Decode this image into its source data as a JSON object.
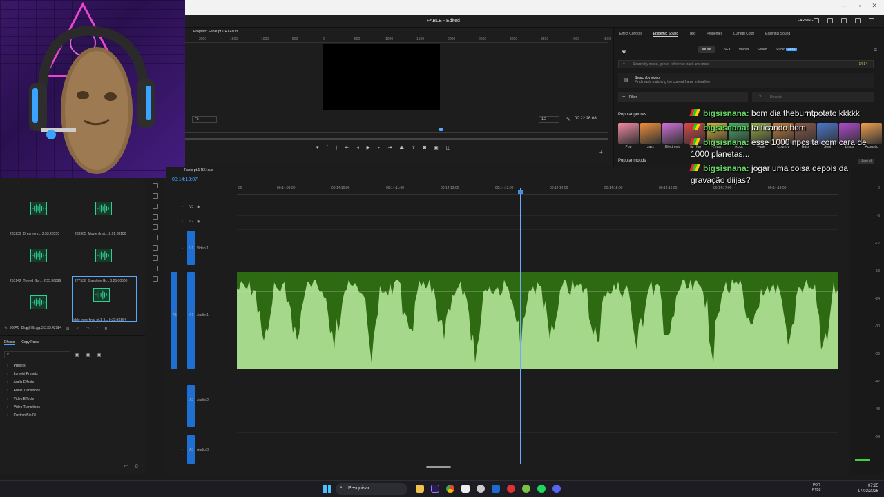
{
  "window": {
    "title": "FABLE - Edited",
    "workspace": "LEARNING"
  },
  "program_monitor": {
    "tab": "Program: Fable pt.1 RX+aud",
    "ruler": [
      "2000",
      "1500",
      "1000",
      "500",
      "0",
      "500",
      "1000",
      "1500",
      "2000",
      "2500",
      "3000",
      "3500",
      "4000",
      "4500"
    ],
    "fit": "Fit",
    "resolution": "1/2",
    "timecode": "00:22:26:08"
  },
  "right_panel": {
    "tabs": [
      "Effect Controls",
      "Epidemic Sound",
      "Text",
      "Properties",
      "Lumetri Color",
      "Essential Sound"
    ],
    "active_tab": "Epidemic Sound",
    "es_tabs": [
      "Music",
      "SFX",
      "Voices",
      "Saved",
      "Studio"
    ],
    "beta": "BETA",
    "search_placeholder": "Search by mood, genre, reference track and more",
    "quota": "14:14",
    "search_by_video": "Search by video",
    "search_by_video_sub": "Find music matching the current frame in timeline",
    "filter": "Filter",
    "sort": "Newest",
    "popular_genres": "Popular genres",
    "popular_moods": "Popular moods",
    "view_all": "View all",
    "genres": [
      {
        "label": "Pop",
        "color": "#f28aa4"
      },
      {
        "label": "Jazz",
        "color": "#ef8f3a"
      },
      {
        "label": "Electronic",
        "color": "#d070d8"
      },
      {
        "label": "Hip Hop",
        "color": "#d94a4a"
      },
      {
        "label": "Beats",
        "color": "#e0b83a"
      },
      {
        "label": "Rock",
        "color": "#48b06a"
      },
      {
        "label": "Funk",
        "color": "#9ab04a"
      },
      {
        "label": "Country",
        "color": "#c8813e"
      },
      {
        "label": "R&B",
        "color": "#8c5a4a"
      },
      {
        "label": "Soul",
        "color": "#4a78d0"
      },
      {
        "label": "Disco",
        "color": "#b04ad0"
      },
      {
        "label": "Acoustic",
        "color": "#f0a050"
      }
    ]
  },
  "project": {
    "clips": [
      {
        "name": "283239_Dreamers...",
        "dur": "2:53:23150"
      },
      {
        "name": "283365_Movie (Inst...",
        "dur": "2:01:28100"
      },
      {
        "name": "253142_Tweed Gor...",
        "dur": "2:55:36899"
      },
      {
        "name": "277536_Gasoline Gr...",
        "dur": "3:25:00600"
      },
      {
        "name": "96043_Blue Hills.mp3",
        "dur": "3:23:42924"
      },
      {
        "name": "fable intro-final-pt.1-3...",
        "dur": "9:33:36854"
      }
    ]
  },
  "effects": {
    "tabs": [
      "Effects",
      "Copy Pasta"
    ],
    "items": [
      "Presets",
      "Lumetri Presets",
      "Audio Effects",
      "Audio Transitions",
      "Video Effects",
      "Video Transitions",
      "Custom Bin 01"
    ]
  },
  "timeline": {
    "tab": "Fable pt.1 RX+aud",
    "timecode": "00:14:13:07",
    "ruler": [
      "00",
      "00:14:09:00",
      "00:14:10:00",
      "00:14:11:00",
      "00:14:12:00",
      "00:14:13:00",
      "00:14:14:00",
      "00:14:15:00",
      "00:14:16:00",
      "00:14:17:00",
      "00:14:18:00"
    ],
    "tracks": {
      "v3": "V3",
      "v2": "V2",
      "v1": "V1",
      "video1": "Video 1",
      "a1": "A1",
      "audio1": "Audio 1",
      "a2": "A2",
      "audio2": "Audio 2",
      "a3": "A3",
      "audio3": "Audio 3"
    },
    "playhead_fraction": 0.47
  },
  "meter_scale": [
    "0",
    "-6",
    "-12",
    "-18",
    "-24",
    "-30",
    "-36",
    "-42",
    "-48",
    "-54"
  ],
  "chat": [
    {
      "user": "bigsisnana:",
      "msg": "bom dia theburntpotato kkkkk"
    },
    {
      "user": "bigsisnana:",
      "msg": "tá ficando bom"
    },
    {
      "user": "bigsisnana:",
      "msg": "esse 1000 npcs ta com cara de 1000 planetas..."
    },
    {
      "user": "bigsisnana:",
      "msg": "jogar uma coisa depois da gravação diijas?"
    }
  ],
  "taskbar": {
    "search": "Pesquisar",
    "lang1": "POR",
    "lang2": "PTB2",
    "time": "07:25",
    "date": "17/02/2026"
  }
}
